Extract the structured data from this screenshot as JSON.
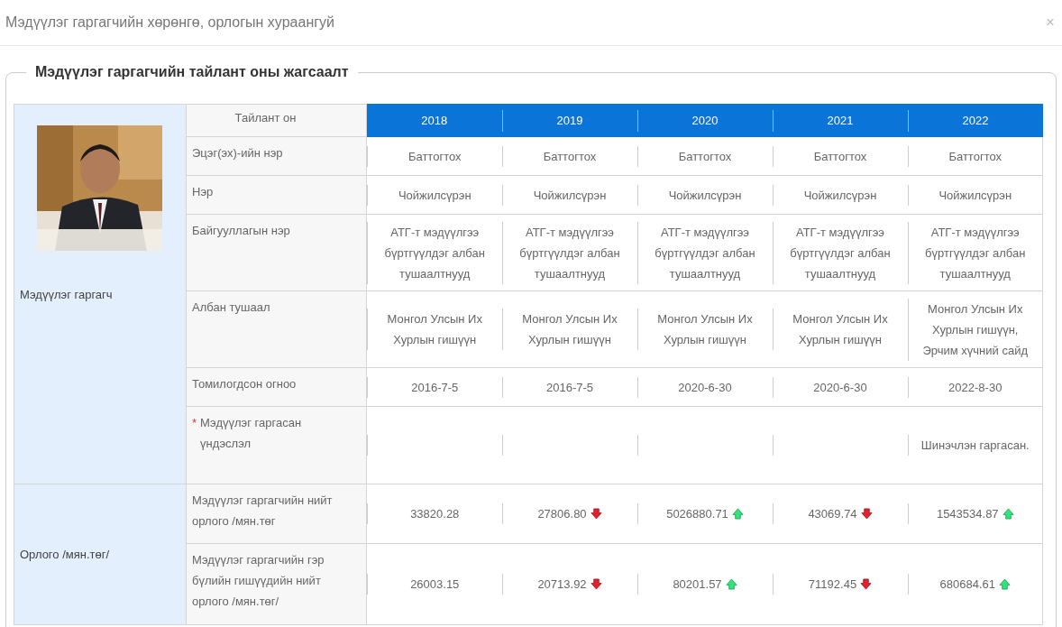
{
  "dialog": {
    "title": "Мэдүүлэг гаргагчийн хөрөнгө, орлогын хураангуй",
    "close": "×"
  },
  "fieldset": {
    "legend": "Мэдүүлэг гаргагчийн тайлант оны жагсаалт"
  },
  "table": {
    "header": {
      "label": "Тайлант он",
      "years": [
        "2018",
        "2019",
        "2020",
        "2021",
        "2022"
      ]
    },
    "sections": [
      {
        "label": "Мэдүүлэг гаргагч",
        "rows": [
          {
            "label": "Эцэг(эх)-ийн нэр",
            "cells": [
              {
                "kind": "plain",
                "value": "Баттогтох"
              },
              {
                "kind": "plain",
                "value": "Баттогтох"
              },
              {
                "kind": "plain",
                "value": "Баттогтох"
              },
              {
                "kind": "plain",
                "value": "Баттогтох"
              },
              {
                "kind": "plain",
                "value": "Баттогтох"
              }
            ]
          },
          {
            "label": "Нэр",
            "cells": [
              {
                "kind": "plain",
                "value": "Чойжилсүрэн"
              },
              {
                "kind": "plain",
                "value": "Чойжилсүрэн"
              },
              {
                "kind": "plain",
                "value": "Чойжилсүрэн"
              },
              {
                "kind": "plain",
                "value": "Чойжилсүрэн"
              },
              {
                "kind": "plain",
                "value": "Чойжилсүрэн"
              }
            ]
          },
          {
            "label": "Байгууллагын нэр",
            "cells": [
              {
                "kind": "plain",
                "value": "АТГ-т мэдүүлгээ бүртгүүлдэг албан тушаалтнууд"
              },
              {
                "kind": "plain",
                "value": "АТГ-т мэдүүлгээ бүртгүүлдэг албан тушаалтнууд"
              },
              {
                "kind": "plain",
                "value": "АТГ-т мэдүүлгээ бүртгүүлдэг албан тушаалтнууд"
              },
              {
                "kind": "plain",
                "value": "АТГ-т мэдүүлгээ бүртгүүлдэг албан тушаалтнууд"
              },
              {
                "kind": "plain",
                "value": "АТГ-т мэдүүлгээ бүртгүүлдэг албан тушаалтнууд"
              }
            ]
          },
          {
            "label": "Албан тушаал",
            "cells": [
              {
                "kind": "plain",
                "value": "Монгол Улсын Их Хурлын гишүүн"
              },
              {
                "kind": "plain",
                "value": "Монгол Улсын Их Хурлын гишүүн"
              },
              {
                "kind": "plain",
                "value": "Монгол Улсын Их Хурлын гишүүн"
              },
              {
                "kind": "plain",
                "value": "Монгол Улсын Их Хурлын гишүүн"
              },
              {
                "kind": "plain",
                "value": "Монгол Улсын Их Хурлын гишүүн, Эрчим хүчний сайд"
              }
            ]
          },
          {
            "label": "Томилогдсон огноо",
            "cells": [
              {
                "kind": "plain",
                "value": "2016-7-5"
              },
              {
                "kind": "plain",
                "value": "2016-7-5"
              },
              {
                "kind": "plain",
                "value": "2020-6-30"
              },
              {
                "kind": "plain",
                "value": "2020-6-30"
              },
              {
                "kind": "plain",
                "value": "2022-8-30"
              }
            ]
          },
          {
            "marker": "*",
            "label": "Мэдүүлэг гаргасан үндэслэл",
            "cells": [
              {
                "kind": "plain"
              },
              {
                "kind": "plain"
              },
              {
                "kind": "plain"
              },
              {
                "kind": "plain"
              },
              {
                "kind": "plain",
                "value": "Шинэчлэн гаргасан."
              }
            ]
          }
        ]
      },
      {
        "label": "Орлого /мян.төг/",
        "rows": [
          {
            "label": "Мэдүүлэг гаргагчийн нийт орлого /мян.төг",
            "cells": [
              {
                "kind": "plain",
                "value": "33820.28"
              },
              {
                "kind": "down",
                "value": "27806.80"
              },
              {
                "kind": "up",
                "value": "5026880.71"
              },
              {
                "kind": "down",
                "value": "43069.74"
              },
              {
                "kind": "up",
                "value": "1543534.87"
              }
            ]
          },
          {
            "label": "Мэдүүлэг гаргагчийн гэр бүлийн гишүүдийн нийт орлого /мян.төг/",
            "cells": [
              {
                "kind": "plain",
                "value": "26003.15"
              },
              {
                "kind": "down",
                "value": "20713.92"
              },
              {
                "kind": "up",
                "value": "80201.57"
              },
              {
                "kind": "down",
                "value": "71192.45"
              },
              {
                "kind": "up",
                "value": "680684.61"
              }
            ]
          }
        ]
      }
    ]
  }
}
